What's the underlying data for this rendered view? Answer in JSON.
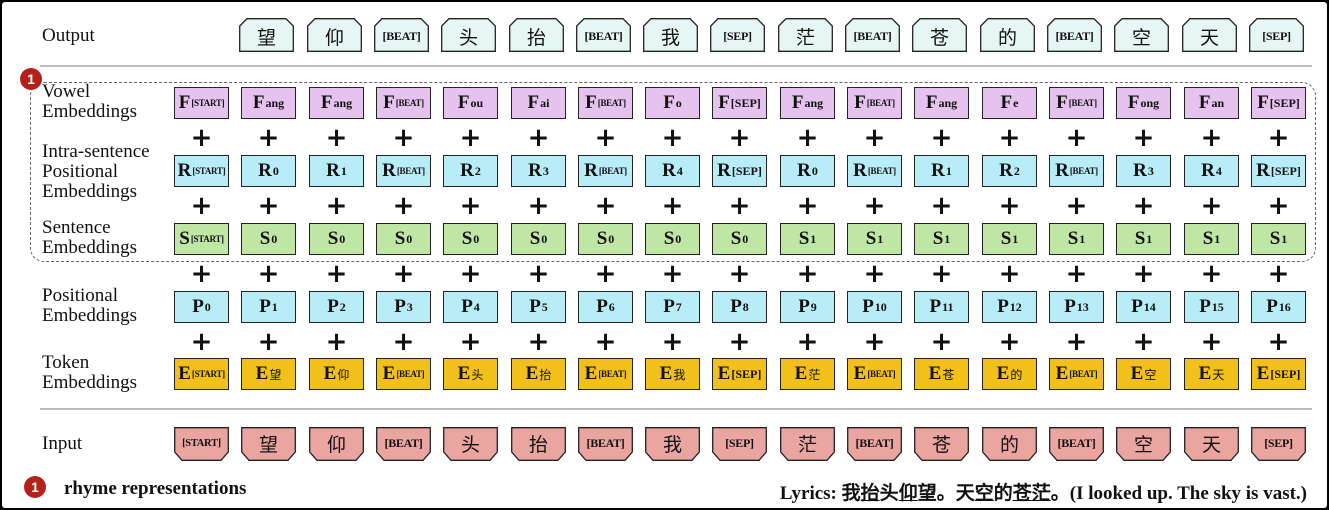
{
  "row_labels": {
    "output": "Output",
    "vowel": [
      "Vowel",
      "Embeddings"
    ],
    "intra": [
      "Intra-sentence",
      "Positional",
      "Embeddings"
    ],
    "sentence": [
      "Sentence",
      "Embeddings"
    ],
    "positional": [
      "Positional",
      "Embeddings"
    ],
    "token": [
      "Token",
      "Embeddings"
    ],
    "input": "Input"
  },
  "output_tokens": [
    "望",
    "仰",
    "[BEAT]",
    "头",
    "抬",
    "[BEAT]",
    "我",
    "[SEP]",
    "茫",
    "[BEAT]",
    "苍",
    "的",
    "[BEAT]",
    "空",
    "天",
    "[SEP]"
  ],
  "input_tokens": [
    "[START]",
    "望",
    "仰",
    "[BEAT]",
    "头",
    "抬",
    "[BEAT]",
    "我",
    "[SEP]",
    "茫",
    "[BEAT]",
    "苍",
    "的",
    "[BEAT]",
    "空",
    "天",
    "[SEP]"
  ],
  "vowel": {
    "base": "F",
    "subs": [
      "[START]",
      "ang",
      "ang",
      "[BEAT]",
      "ou",
      "ai",
      "[BEAT]",
      "o",
      "[SEP]",
      "ang",
      "[BEAT]",
      "ang",
      "e",
      "[BEAT]",
      "ong",
      "an",
      "[SEP]"
    ]
  },
  "intra": {
    "base": "R",
    "subs": [
      "[START]",
      "0",
      "1",
      "[BEAT]",
      "2",
      "3",
      "[BEAT]",
      "4",
      "[SEP]",
      "0",
      "[BEAT]",
      "1",
      "2",
      "[BEAT]",
      "3",
      "4",
      "[SEP]"
    ]
  },
  "sentence": {
    "base": "S",
    "subs": [
      "[START]",
      "0",
      "0",
      "0",
      "0",
      "0",
      "0",
      "0",
      "0",
      "1",
      "1",
      "1",
      "1",
      "1",
      "1",
      "1",
      "1"
    ]
  },
  "positional": {
    "base": "P",
    "subs": [
      "0",
      "1",
      "2",
      "3",
      "4",
      "5",
      "6",
      "7",
      "8",
      "9",
      "10",
      "11",
      "12",
      "13",
      "14",
      "15",
      "16"
    ]
  },
  "token": {
    "base": "E",
    "subs": [
      "[START]",
      "望",
      "仰",
      "[BEAT]",
      "头",
      "抬",
      "[BEAT]",
      "我",
      "[SEP]",
      "茫",
      "[BEAT]",
      "苍",
      "的",
      "[BEAT]",
      "空",
      "天",
      "[SEP]"
    ]
  },
  "plus": "+",
  "badge_number": "1",
  "legend": "rhyme representations",
  "lyrics": {
    "prefix": "Lyrics: ",
    "parts": [
      {
        "t": "我",
        "u": false
      },
      {
        "t": "抬",
        "u": true
      },
      {
        "t": "头",
        "u": false
      },
      {
        "t": "仰",
        "u": true
      },
      {
        "t": "望。天",
        "u": false
      },
      {
        "t": "空",
        "u": true
      },
      {
        "t": "的",
        "u": false
      },
      {
        "t": "苍",
        "u": true
      },
      {
        "t": "茫",
        "u": true
      },
      {
        "t": "。(I looked up. The sky is vast.)",
        "u": false
      }
    ]
  },
  "colors": {
    "output": "#e6f6f4",
    "vowel": "#e6c2ee",
    "intra": "#b8ecf6",
    "sentence": "#bfe6a5",
    "positional": "#b8ecf6",
    "token": "#f1c01b",
    "input": "#eba5a1",
    "badge": "#b4201a"
  }
}
